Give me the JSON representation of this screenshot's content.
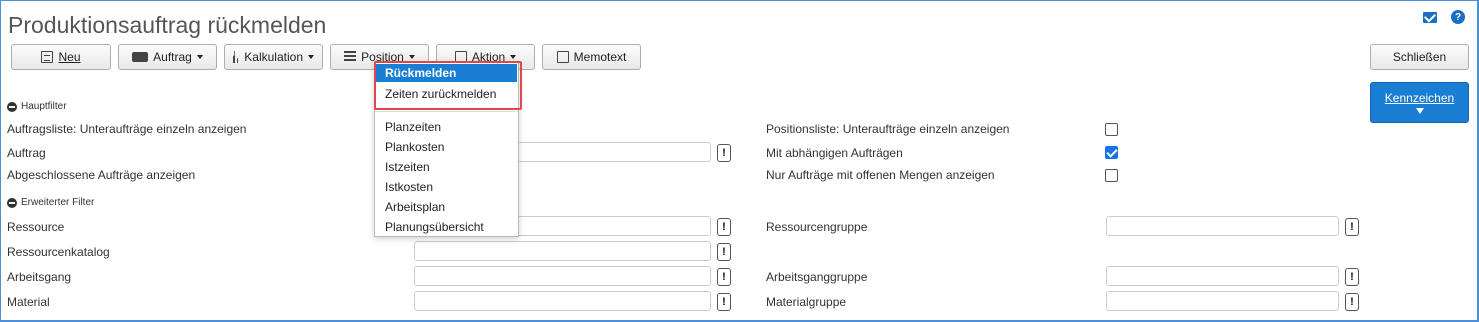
{
  "title": "Produktionsauftrag rückmelden",
  "toolbar": {
    "neu": "Neu",
    "auftrag": "Auftrag",
    "kalkulation": "Kalkulation",
    "position": "Position",
    "aktion": "Aktion",
    "memotext": "Memotext",
    "schliessen": "Schließen"
  },
  "hauptfilter": {
    "title": "Hauptfilter",
    "auftragsliste": "Auftragsliste: Unteraufträge einzeln anzeigen",
    "auftrag": "Auftrag",
    "abgeschlossene": "Abgeschlossene Aufträge anzeigen",
    "positionsliste": "Positionsliste: Unteraufträge einzeln anzeigen",
    "abhaengig": "Mit abhängigen Aufträgen",
    "offene": "Nur Aufträge mit offenen Mengen anzeigen"
  },
  "erweitert": {
    "title": "Erweiterter Filter",
    "ressource": "Ressource",
    "ressourcenkatalog": "Ressourcenkatalog",
    "arbeitsgang": "Arbeitsgang",
    "material": "Material",
    "ressourcengruppe": "Ressourcengruppe",
    "arbeitsganggruppe": "Arbeitsganggruppe",
    "materialgruppe": "Materialgruppe"
  },
  "kennzeichen": "Kennzeichen",
  "excl": "!",
  "help": "?",
  "menu": {
    "rueckmelden": "Rückmelden",
    "zeiten": "Zeiten zurückmelden",
    "planzeiten": "Planzeiten",
    "plankosten": "Plankosten",
    "istzeiten": "Istzeiten",
    "istkosten": "Istkosten",
    "arbeitsplan": "Arbeitsplan",
    "planungsuebersicht": "Planungsübersicht"
  },
  "checkboxes": {
    "positionsliste": false,
    "abhaengig": true,
    "offene": false
  }
}
